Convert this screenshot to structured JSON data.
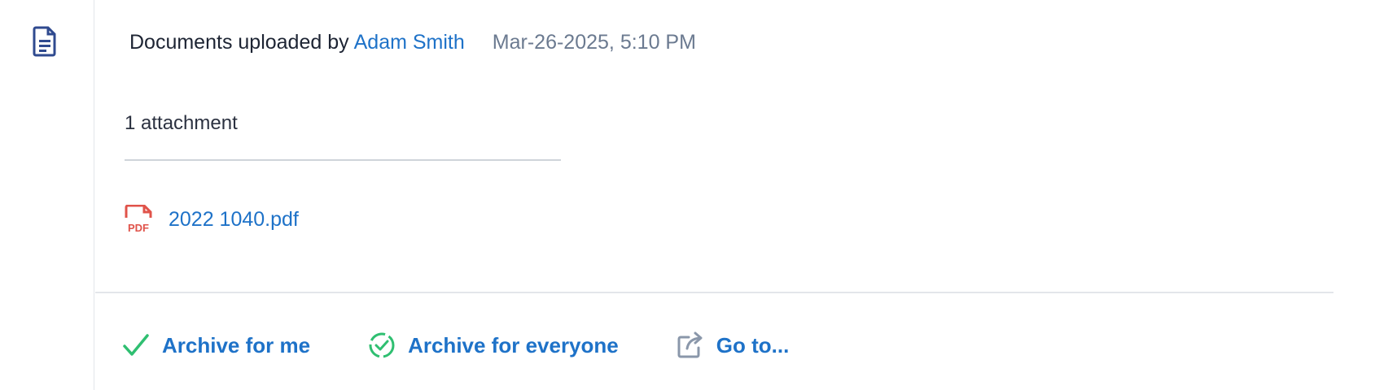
{
  "event": {
    "icon": "document-icon",
    "lead_text": "Documents uploaded by",
    "author": "Adam Smith",
    "timestamp": "Mar-26-2025, 5:10 PM"
  },
  "attachments": {
    "count_label": "1 attachment",
    "files": [
      {
        "name": "2022 1040.pdf",
        "icon": "pdf-file-icon"
      }
    ]
  },
  "actions": {
    "archive_me": {
      "label": "Archive for me",
      "icon": "check-icon"
    },
    "archive_everyone": {
      "label": "Archive for everyone",
      "icon": "dashed-check-circle-icon"
    },
    "go_to": {
      "label": "Go to...",
      "icon": "share-arrow-icon"
    }
  },
  "colors": {
    "link": "#1e72c8",
    "pdf": "#e0534a",
    "check": "#2fbf71",
    "doc_icon": "#2f4a8f",
    "muted": "#6b7a90"
  }
}
